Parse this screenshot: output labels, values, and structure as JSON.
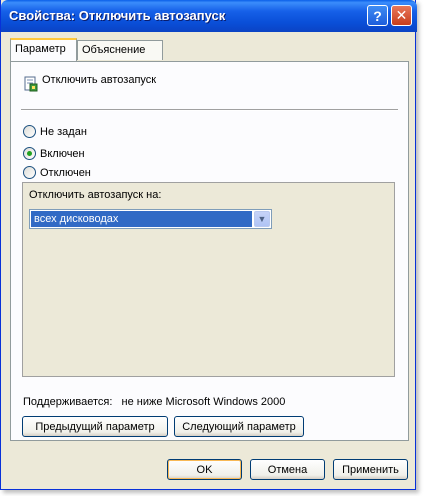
{
  "window": {
    "title": "Свойства: Отключить автозапуск"
  },
  "tabs": [
    {
      "label": "Параметр"
    },
    {
      "label": "Объяснение"
    }
  ],
  "policy": {
    "name": "Отключить автозапуск"
  },
  "radios": [
    {
      "label": "Не задан",
      "checked": false
    },
    {
      "label": "Включен",
      "checked": true
    },
    {
      "label": "Отключен",
      "checked": false
    }
  ],
  "options": {
    "label": "Отключить автозапуск на:",
    "selected": "всех дисководах"
  },
  "supported": {
    "label": "Поддерживается:",
    "value": "не ниже Microsoft Windows 2000"
  },
  "nav": {
    "prev": "Предыдущий параметр",
    "next": "Следующий параметр"
  },
  "buttons": {
    "ok": "OK",
    "cancel": "Отмена",
    "apply": "Применить"
  },
  "titlebar_buttons": {
    "help": "?",
    "close": "✕"
  }
}
